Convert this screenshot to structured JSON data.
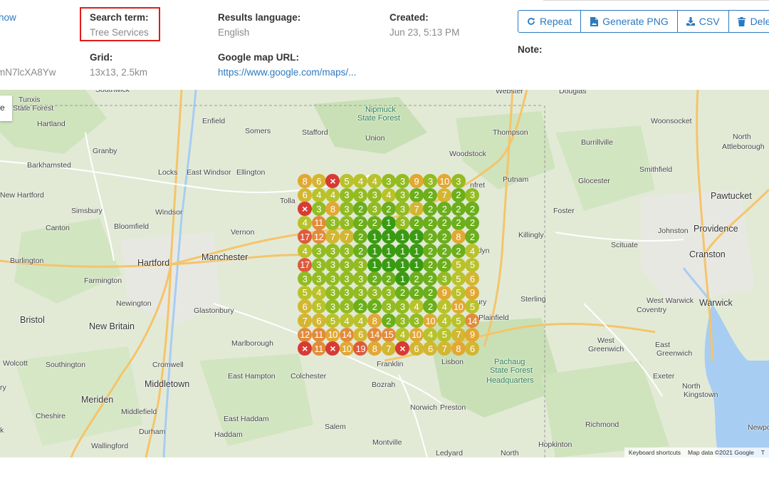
{
  "header": {
    "partial_link_left": "how",
    "partial_id_left": "mN7lcXA8Yw",
    "search_term_label": "Search term:",
    "search_term_value": "Tree Services",
    "grid_label": "Grid:",
    "grid_value": "13x13, 2.5km",
    "results_language_label": "Results language:",
    "results_language_value": "English",
    "google_map_url_label": "Google map URL:",
    "google_map_url_value": "https://www.google.com/maps/...",
    "created_label": "Created:",
    "created_value": "Jun 23, 5:13 PM",
    "note_label": "Note:"
  },
  "actions": {
    "repeat_label": "Repeat",
    "generate_png_label": "Generate PNG",
    "csv_label": "CSV",
    "delete_label": "Dele"
  },
  "map": {
    "control_partial": "e",
    "attribution_shortcuts": "Keyboard shortcuts",
    "attribution_data": "Map data ©2021 Google",
    "attribution_terms": "T",
    "places": [
      {
        "text": "Tunxis",
        "cls": ""
      },
      {
        "text": "State Forest",
        "cls": ""
      },
      {
        "text": "Hartland",
        "cls": ""
      },
      {
        "text": "Granby",
        "cls": ""
      },
      {
        "text": "Barkhamsted",
        "cls": ""
      },
      {
        "text": "New Hartford",
        "cls": ""
      },
      {
        "text": "Simsbury",
        "cls": ""
      },
      {
        "text": "Canton",
        "cls": ""
      },
      {
        "text": "Bloomfield",
        "cls": ""
      },
      {
        "text": "Windsor",
        "cls": ""
      },
      {
        "text": "Locks",
        "cls": ""
      },
      {
        "text": "East Windsor",
        "cls": ""
      },
      {
        "text": "Ellington",
        "cls": ""
      },
      {
        "text": "Enfield",
        "cls": ""
      },
      {
        "text": "Somers",
        "cls": ""
      },
      {
        "text": "Stafford",
        "cls": ""
      },
      {
        "text": "Union",
        "cls": ""
      },
      {
        "text": "Nipmuck",
        "cls": "park"
      },
      {
        "text": "State Forest",
        "cls": "park"
      },
      {
        "text": "Southwick",
        "cls": ""
      },
      {
        "text": "Webster",
        "cls": ""
      },
      {
        "text": "Douglas",
        "cls": ""
      },
      {
        "text": "Thompson",
        "cls": ""
      },
      {
        "text": "Woodstock",
        "cls": ""
      },
      {
        "text": "Woonsocket",
        "cls": ""
      },
      {
        "text": "Burrillville",
        "cls": ""
      },
      {
        "text": "North",
        "cls": ""
      },
      {
        "text": "Attleborough",
        "cls": ""
      },
      {
        "text": "Smithfield",
        "cls": ""
      },
      {
        "text": "Putnam",
        "cls": ""
      },
      {
        "text": "Glocester",
        "cls": ""
      },
      {
        "text": "Pawtucket",
        "cls": "city"
      },
      {
        "text": "Providence",
        "cls": "big"
      },
      {
        "text": "Foster",
        "cls": ""
      },
      {
        "text": "Johnston",
        "cls": ""
      },
      {
        "text": "Killingly",
        "cls": ""
      },
      {
        "text": "Scituate",
        "cls": ""
      },
      {
        "text": "Cranston",
        "cls": "city"
      },
      {
        "text": "Burlington",
        "cls": ""
      },
      {
        "text": "Hartford",
        "cls": "big"
      },
      {
        "text": "Manchester",
        "cls": "city"
      },
      {
        "text": "Vernon",
        "cls": ""
      },
      {
        "text": "Tolla",
        "cls": ""
      },
      {
        "text": "Farmington",
        "cls": ""
      },
      {
        "text": "Newington",
        "cls": ""
      },
      {
        "text": "Glastonbury",
        "cls": ""
      },
      {
        "text": "Bristol",
        "cls": "city"
      },
      {
        "text": "New Britain",
        "cls": "city"
      },
      {
        "text": "Marlborough",
        "cls": ""
      },
      {
        "text": "Southington",
        "cls": ""
      },
      {
        "text": "Cromwell",
        "cls": ""
      },
      {
        "text": "Wolcott",
        "cls": ""
      },
      {
        "text": "East Hampton",
        "cls": ""
      },
      {
        "text": "Colchester",
        "cls": ""
      },
      {
        "text": "Middletown",
        "cls": "city"
      },
      {
        "text": "Meriden",
        "cls": "city"
      },
      {
        "text": "Cheshire",
        "cls": ""
      },
      {
        "text": "Middlefield",
        "cls": ""
      },
      {
        "text": "Durham",
        "cls": ""
      },
      {
        "text": "Wallingford",
        "cls": ""
      },
      {
        "text": "East Haddam",
        "cls": ""
      },
      {
        "text": "Haddam",
        "cls": ""
      },
      {
        "text": "Salem",
        "cls": ""
      },
      {
        "text": "Bozrah",
        "cls": ""
      },
      {
        "text": "Franklin",
        "cls": ""
      },
      {
        "text": "Norwich",
        "cls": ""
      },
      {
        "text": "Preston",
        "cls": ""
      },
      {
        "text": "Montville",
        "cls": ""
      },
      {
        "text": "Ledyard",
        "cls": ""
      },
      {
        "text": "North",
        "cls": ""
      },
      {
        "text": "Lisbon",
        "cls": ""
      },
      {
        "text": "Pachaug",
        "cls": "park"
      },
      {
        "text": "State Forest",
        "cls": "park"
      },
      {
        "text": "Headquarters",
        "cls": "park"
      },
      {
        "text": "Sterling",
        "cls": ""
      },
      {
        "text": "Plainfield",
        "cls": ""
      },
      {
        "text": "West Warwick",
        "cls": ""
      },
      {
        "text": "Coventry",
        "cls": ""
      },
      {
        "text": "Warwick",
        "cls": "city"
      },
      {
        "text": "West",
        "cls": ""
      },
      {
        "text": "Greenwich",
        "cls": ""
      },
      {
        "text": "East",
        "cls": ""
      },
      {
        "text": "Greenwich",
        "cls": ""
      },
      {
        "text": "Exeter",
        "cls": ""
      },
      {
        "text": "North",
        "cls": ""
      },
      {
        "text": "Kingstown",
        "cls": ""
      },
      {
        "text": "Richmond",
        "cls": ""
      },
      {
        "text": "Hopkinton",
        "cls": ""
      },
      {
        "text": "Newpo",
        "cls": ""
      },
      {
        "text": "nfret",
        "cls": ""
      },
      {
        "text": "oklyn",
        "cls": ""
      },
      {
        "text": "bury",
        "cls": ""
      },
      {
        "text": "ry",
        "cls": ""
      },
      {
        "text": "k",
        "cls": ""
      }
    ]
  },
  "rank_grid": {
    "rows": 13,
    "cols": 13,
    "not_found_symbol": "×",
    "values": [
      [
        "8",
        "6",
        "x",
        "5",
        "4",
        "4",
        "3",
        "3",
        "9",
        "3",
        "10",
        "3",
        ""
      ],
      [
        "6",
        "4",
        "4",
        "3",
        "3",
        "3",
        "4",
        "3",
        "2",
        "2",
        "7",
        "2",
        "3"
      ],
      [
        "x",
        "3",
        "8",
        "3",
        "2",
        "3",
        "2",
        "3",
        "7",
        "2",
        "2",
        "2",
        "2"
      ],
      [
        "4",
        "11",
        "3",
        "3",
        "2",
        "2",
        "1",
        "3",
        "2",
        "2",
        "2",
        "2",
        "2"
      ],
      [
        "17",
        "12",
        "7",
        "7",
        "2",
        "1",
        "1",
        "1",
        "1",
        "2",
        "2",
        "8",
        "2"
      ],
      [
        "4",
        "3",
        "3",
        "3",
        "2",
        "1",
        "1",
        "1",
        "1",
        "2",
        "2",
        "2",
        "4"
      ],
      [
        "17",
        "3",
        "3",
        "3",
        "3",
        "1",
        "1",
        "1",
        "1",
        "2",
        "2",
        "5",
        "5"
      ],
      [
        "3",
        "3",
        "3",
        "3",
        "3",
        "2",
        "2",
        "1",
        "2",
        "2",
        "3",
        "5",
        "6"
      ],
      [
        "5",
        "4",
        "3",
        "3",
        "3",
        "3",
        "3",
        "2",
        "2",
        "2",
        "9",
        "5",
        "9"
      ],
      [
        "6",
        "5",
        "3",
        "3",
        "2",
        "2",
        "3",
        "3",
        "4",
        "2",
        "4",
        "10",
        "5"
      ],
      [
        "7",
        "6",
        "5",
        "4",
        "4",
        "8",
        "2",
        "3",
        "3",
        "10",
        "4",
        "5",
        "14"
      ],
      [
        "12",
        "11",
        "10",
        "14",
        "6",
        "14",
        "15",
        "4",
        "10",
        "4",
        "5",
        "7",
        "9"
      ],
      [
        "x",
        "11",
        "x",
        "10",
        "19",
        "8",
        "7",
        "x",
        "6",
        "6",
        "7",
        "8",
        "6"
      ]
    ]
  }
}
